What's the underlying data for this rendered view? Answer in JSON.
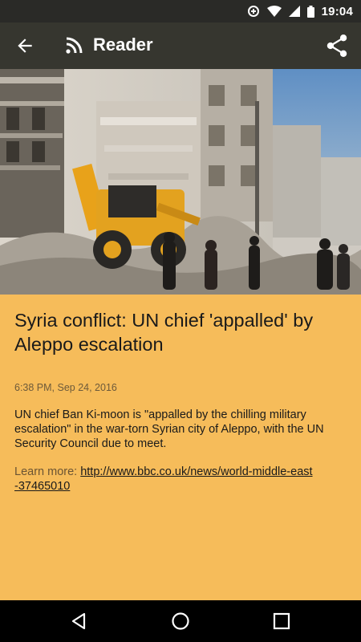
{
  "status_bar": {
    "time": "19:04",
    "icons": [
      "data-saver-icon",
      "wifi-icon",
      "cell-signal-icon",
      "battery-icon"
    ]
  },
  "app_bar": {
    "title": "Reader",
    "icons": [
      "back-arrow-icon",
      "rss-icon",
      "share-icon"
    ]
  },
  "article": {
    "headline": "Syria conflict: UN chief 'appalled' by Aleppo escalation",
    "timestamp": "6:38 PM, Sep 24, 2016",
    "summary": "UN chief Ban Ki-moon is \"appalled by the chilling military escalation\" in the war-torn Syrian city of Aleppo, with the UN Security Council due to meet.",
    "learn_more_label": "Learn more:",
    "link_line1": "http://www.bbc.co.uk/news/world-middle-east",
    "link_line2": "-37465010"
  },
  "colors": {
    "background": "#F6BC5A",
    "status_bar": "#2a2a27",
    "app_bar": "#36362f",
    "nav_bar": "#000000"
  },
  "nav_bar": {
    "icons": [
      "nav-back-icon",
      "nav-home-icon",
      "nav-recents-icon"
    ]
  }
}
